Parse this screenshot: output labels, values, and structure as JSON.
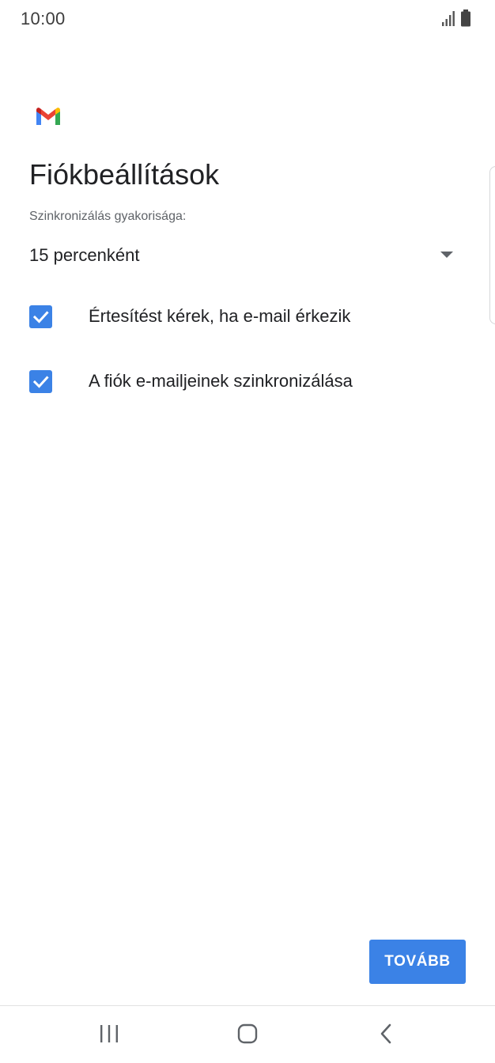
{
  "status_bar": {
    "time": "10:00",
    "icons": [
      "signal-icon",
      "battery-icon"
    ]
  },
  "app": {
    "logo": "gmail-logo"
  },
  "page": {
    "title": "Fiókbeállítások",
    "sync_label": "Szinkronizálás gyakorisága:",
    "sync_value": "15 percenként"
  },
  "options": [
    {
      "label": "Értesítést kérek, ha e-mail érkezik",
      "checked": true
    },
    {
      "label": "A fiók e-mailjeinek szinkronizálása",
      "checked": true
    }
  ],
  "actions": {
    "next_label": "TOVÁBB"
  },
  "navigation": {
    "buttons": [
      "recent-apps-icon",
      "home-icon",
      "back-icon"
    ]
  },
  "colors": {
    "accent": "#3b82e6",
    "text_primary": "#202124",
    "text_secondary": "#5f6368"
  }
}
